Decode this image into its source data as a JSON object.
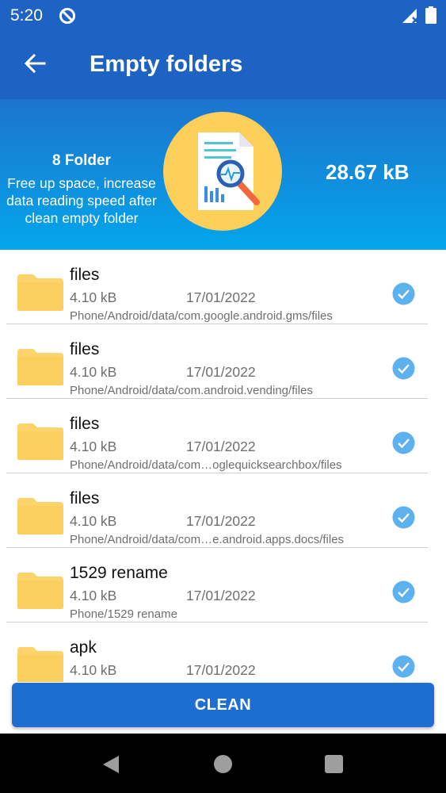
{
  "status_bar": {
    "time": "5:20",
    "icons": [
      "dnd-icon",
      "signal-icon",
      "battery-icon"
    ]
  },
  "header": {
    "title": "Empty folders",
    "back_icon": "arrow-left-icon"
  },
  "summary": {
    "folder_count": "8 Folder",
    "description": "Free up space, increase data reading speed after clean empty folder",
    "total_size": "28.67 kB",
    "illustration": "document-search-icon"
  },
  "folders": [
    {
      "name": "files",
      "size": "4.10 kB",
      "date": "17/01/2022",
      "path": "Phone/Android/data/com.google.android.gms/files",
      "checked": true
    },
    {
      "name": "files",
      "size": "4.10 kB",
      "date": "17/01/2022",
      "path": "Phone/Android/data/com.android.vending/files",
      "checked": true
    },
    {
      "name": "files",
      "size": "4.10 kB",
      "date": "17/01/2022",
      "path": "Phone/Android/data/com…oglequicksearchbox/files",
      "checked": true
    },
    {
      "name": "files",
      "size": "4.10 kB",
      "date": "17/01/2022",
      "path": "Phone/Android/data/com…e.android.apps.docs/files",
      "checked": true
    },
    {
      "name": "1529 rename",
      "size": "4.10 kB",
      "date": "17/01/2022",
      "path": "Phone/1529 rename",
      "checked": true
    },
    {
      "name": "apk",
      "size": "4.10 kB",
      "date": "17/01/2022",
      "path": "",
      "checked": true
    }
  ],
  "actions": {
    "clean_label": "CLEAN"
  },
  "nav_bar": {
    "icons": [
      "back-triangle-icon",
      "home-circle-icon",
      "recents-square-icon"
    ]
  },
  "colors": {
    "primary": "#1e63c4",
    "hero_gradient_end": "#03a6ec",
    "accent_circle": "#fccf5a",
    "folder": "#fdd46b",
    "check": "#5eb1ef"
  }
}
